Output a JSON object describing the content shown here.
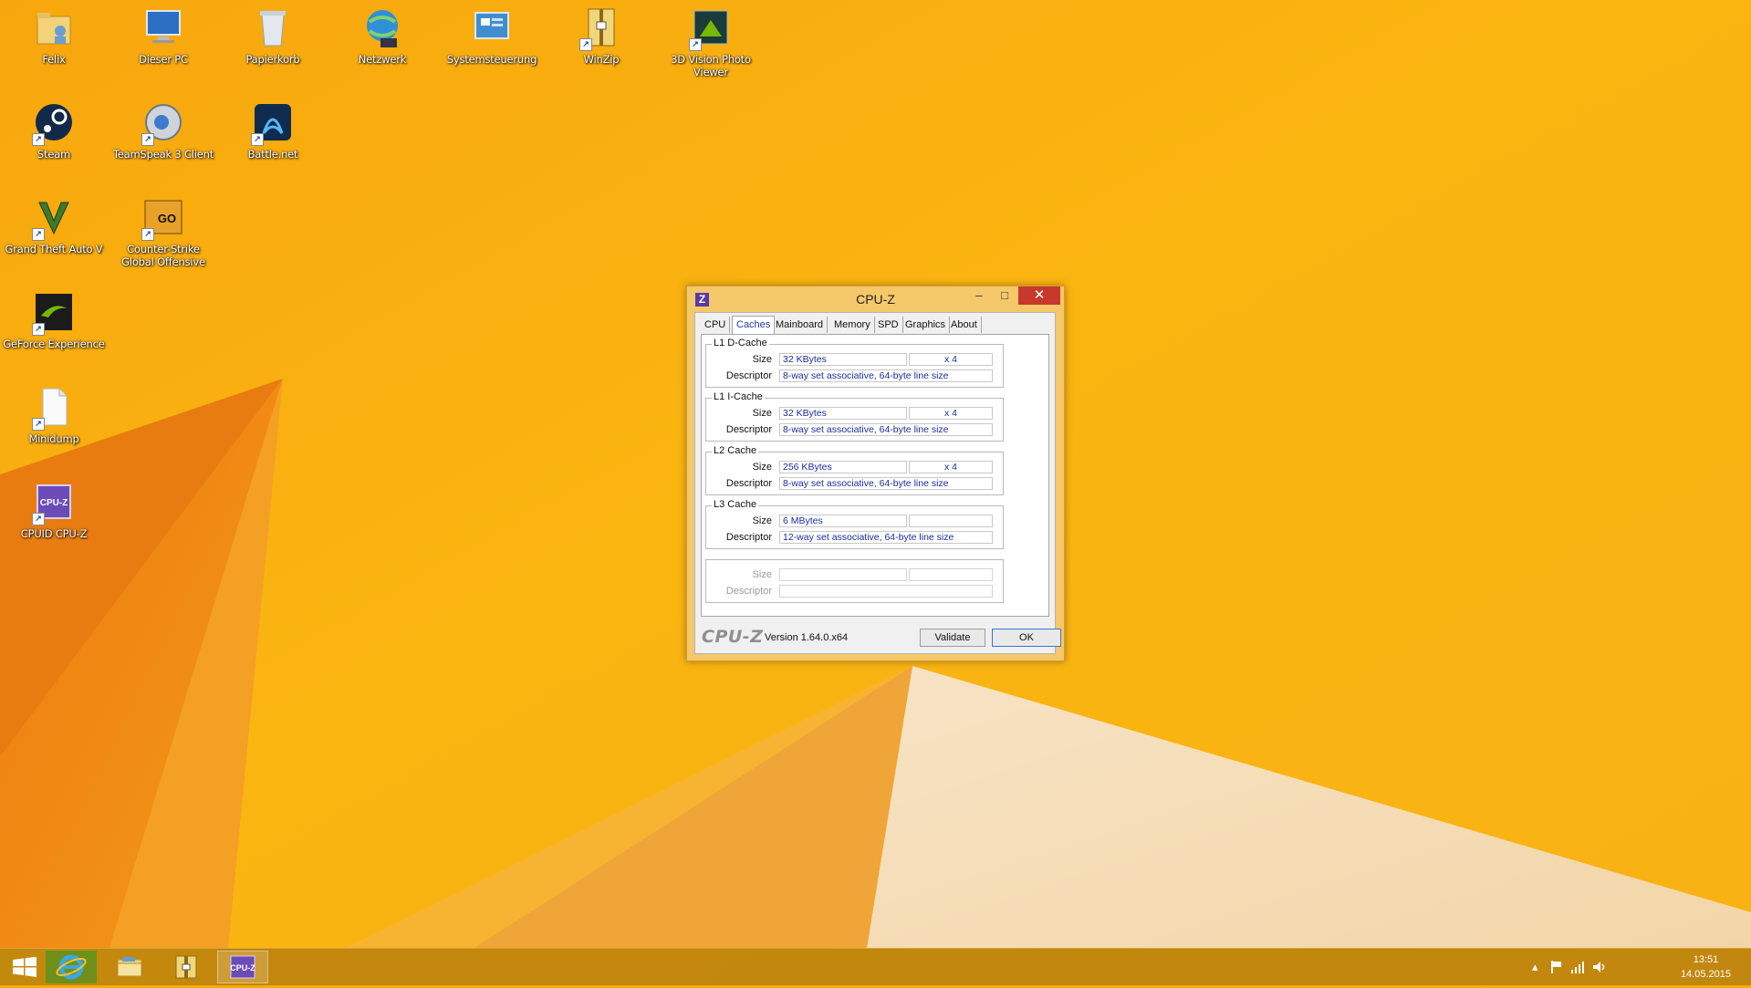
{
  "desktop": {
    "icons": [
      {
        "label": "Felix",
        "icon": "user-folder-icon"
      },
      {
        "label": "Dieser PC",
        "icon": "computer-icon"
      },
      {
        "label": "Papierkorb",
        "icon": "recycle-bin-icon"
      },
      {
        "label": "Netzwerk",
        "icon": "network-icon"
      },
      {
        "label": "Systemsteuerung",
        "icon": "control-panel-icon"
      },
      {
        "label": "WinZip",
        "icon": "winzip-icon"
      },
      {
        "label": "3D Vision Photo Viewer",
        "icon": "3d-vision-icon"
      },
      {
        "label": "Steam",
        "icon": "steam-icon"
      },
      {
        "label": "TeamSpeak 3 Client",
        "icon": "teamspeak-icon"
      },
      {
        "label": "Battle.net",
        "icon": "battlenet-icon"
      },
      {
        "label": "Grand Theft Auto V",
        "icon": "gta-icon"
      },
      {
        "label": "Counter-Strike Global Offensive",
        "icon": "csgo-icon"
      },
      {
        "label": "GeForce Experience",
        "icon": "geforce-icon"
      },
      {
        "label": "Minidump",
        "icon": "document-icon"
      },
      {
        "label": "CPUID CPU-Z",
        "icon": "cpuz-icon"
      }
    ]
  },
  "window": {
    "title": "CPU-Z",
    "app_icon_letter": "Z",
    "minimize": "–",
    "maximize": "□",
    "close": "✕",
    "tabs": [
      "CPU",
      "Caches",
      "Mainboard",
      "Memory",
      "SPD",
      "Graphics",
      "About"
    ],
    "active_tab": "Caches",
    "groups": [
      {
        "title": "L1 D-Cache",
        "size_label": "Size",
        "size": "32 KBytes",
        "count": "x 4",
        "desc_label": "Descriptor",
        "descriptor": "8-way set associative, 64-byte line size"
      },
      {
        "title": "L1 I-Cache",
        "size_label": "Size",
        "size": "32 KBytes",
        "count": "x 4",
        "desc_label": "Descriptor",
        "descriptor": "8-way set associative, 64-byte line size"
      },
      {
        "title": "L2 Cache",
        "size_label": "Size",
        "size": "256 KBytes",
        "count": "x 4",
        "desc_label": "Descriptor",
        "descriptor": "8-way set associative, 64-byte line size"
      },
      {
        "title": "L3 Cache",
        "size_label": "Size",
        "size": "6 MBytes",
        "count": "",
        "desc_label": "Descriptor",
        "descriptor": "12-way set associative, 64-byte line size"
      },
      {
        "title": "",
        "size_label": "Size",
        "size": "",
        "count": "",
        "desc_label": "Descriptor",
        "descriptor": ""
      }
    ],
    "brand": "CPU-Z",
    "version": "Version 1.64.0.x64",
    "validate": "Validate",
    "ok": "OK"
  },
  "taskbar": {
    "items": [
      "start-icon",
      "internet-explorer-icon",
      "file-explorer-icon",
      "winzip-icon",
      "cpuz-icon"
    ],
    "time": "13:51",
    "date": "14.05.2015",
    "tray_up": "▴"
  },
  "colors": {
    "wallpaper": "#f6ac0c",
    "close_button": "#c7392d",
    "field_text": "#1b2d9e"
  }
}
